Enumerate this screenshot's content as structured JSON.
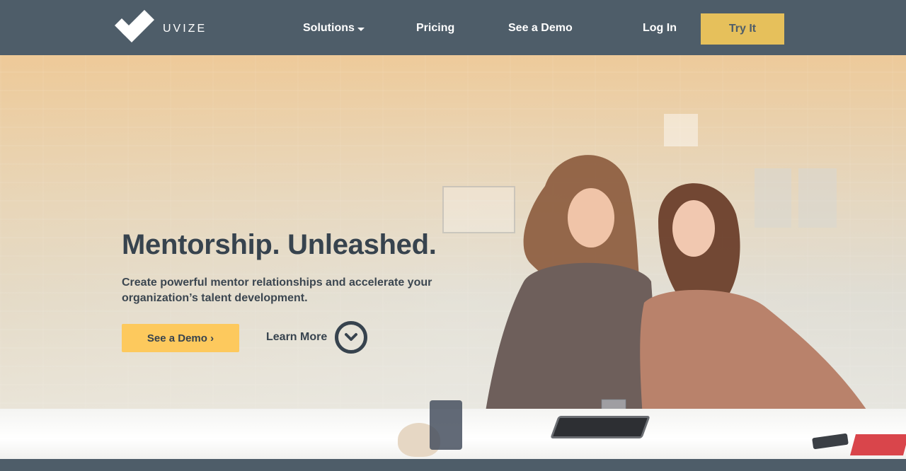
{
  "brand": {
    "name": "UVIZE",
    "logo_icon": "uvize-logo-icon"
  },
  "nav": {
    "items": [
      {
        "label": "Solutions",
        "has_dropdown": true
      },
      {
        "label": "Pricing"
      },
      {
        "label": "See a Demo"
      },
      {
        "label": "Log In"
      }
    ],
    "cta_label": "Try It"
  },
  "hero": {
    "title": "Mentorship. Unleashed.",
    "subtitle": "Create powerful mentor relationships and accelerate your organization’s talent development.",
    "primary_cta": "See a Demo ›",
    "secondary_cta": "Learn More",
    "secondary_icon": "chevron-down-circle-icon"
  },
  "colors": {
    "nav_bg": "#4e5d69",
    "cta_gold": "#e6c05b",
    "demo_yellow": "#fdc95d",
    "text_dark": "#37434e"
  }
}
